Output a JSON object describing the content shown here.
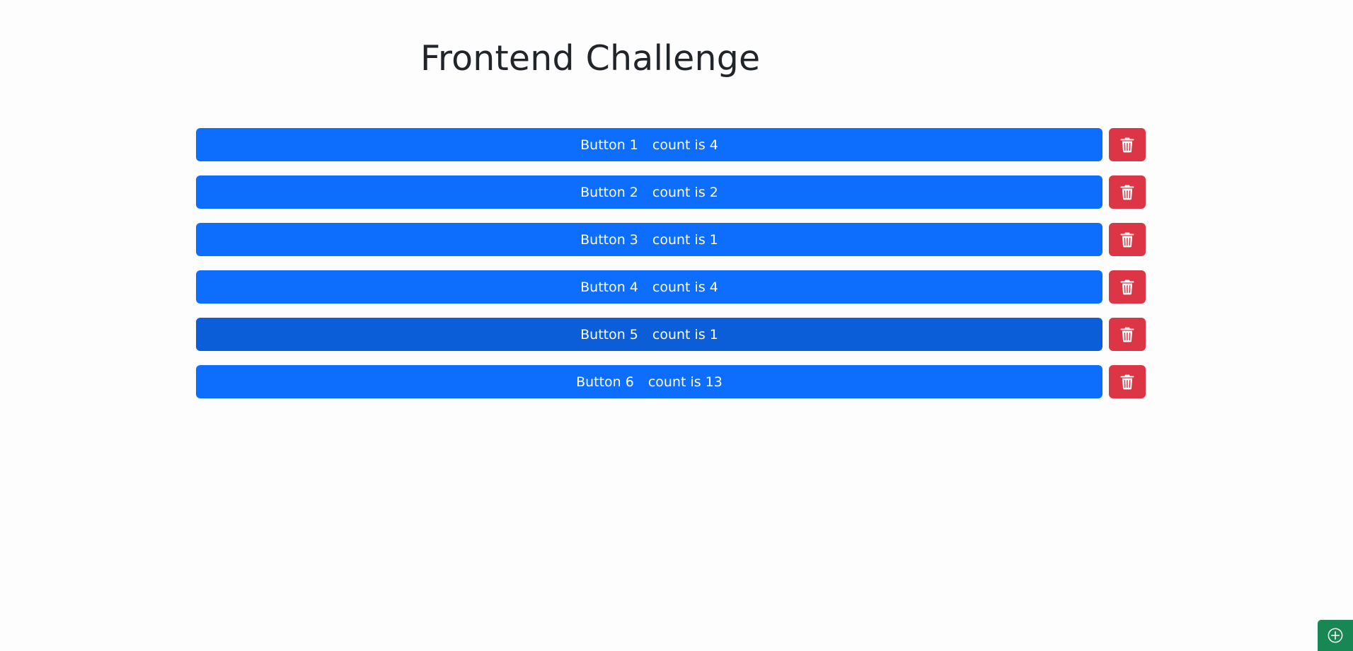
{
  "page": {
    "title": "Frontend Challenge"
  },
  "buttons": [
    {
      "label": "Button 1",
      "count_text": "count is 4",
      "active": false
    },
    {
      "label": "Button 2",
      "count_text": "count is 2",
      "active": false
    },
    {
      "label": "Button 3",
      "count_text": "count is 1",
      "active": false
    },
    {
      "label": "Button 4",
      "count_text": "count is 4",
      "active": false
    },
    {
      "label": "Button 5",
      "count_text": "count is 1",
      "active": true
    },
    {
      "label": "Button 6",
      "count_text": "count is 13",
      "active": false
    }
  ],
  "icons": {
    "delete": "trash-icon",
    "add": "plus-circle-icon"
  },
  "colors": {
    "primary": "#0d6efd",
    "primary_active": "#0b5ed7",
    "danger": "#dc3545",
    "success": "#198754",
    "title_text": "#212529"
  }
}
